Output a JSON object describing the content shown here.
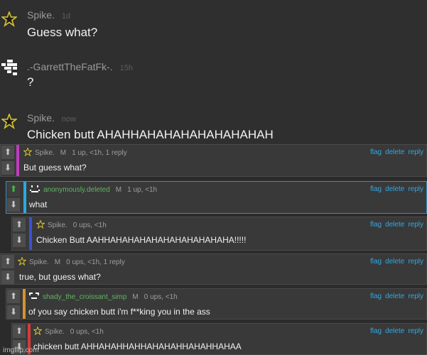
{
  "chat": {
    "messages": [
      {
        "user": "Spike.",
        "time": "1d",
        "text": "Guess what?",
        "avatar": "star-icon"
      },
      {
        "user": ".-GarrettTheFatFk-.",
        "time": "15h",
        "text": "?",
        "avatar": "pixel-avatar-icon"
      },
      {
        "user": "Spike.",
        "time": "now",
        "text": "Chicken butt AHAHHAHAHAHAHAHAHAHAH",
        "avatar": "star-icon"
      }
    ]
  },
  "replies": [
    {
      "user": "Spike.",
      "mod": "M",
      "meta": "1 up, <1h, 1 reply",
      "text": "But guess what?",
      "bar_color": "#c13ac1",
      "upvoted": false
    },
    {
      "user": "anonymously.deleted",
      "mod": "M",
      "meta": "1 up, <1h",
      "text": "what",
      "bar_color": "#2aa9e0",
      "upvoted": true
    },
    {
      "user": "Spike.",
      "mod": "",
      "meta": "0 ups, <1h",
      "text": "Chicken Butt AAHHAHAHAHAHAHAHAHAHAHAHA!!!!!",
      "bar_color": "#3b50d6",
      "upvoted": false
    },
    {
      "user": "Spike.",
      "mod": "M",
      "meta": "0 ups, <1h, 1 reply",
      "text": "true, but guess what?",
      "bar_color": "",
      "upvoted": false
    },
    {
      "user": "shady_the_croissant_simp",
      "mod": "M",
      "meta": "0 ups, <1h",
      "text": "of you say chicken butt i'm f**king you in the ass",
      "bar_color": "#d9902a",
      "upvoted": false
    },
    {
      "user": "Spike.",
      "mod": "",
      "meta": "0 ups, <1h",
      "text": "chicken butt AHHAHAHHAHHAHAHAHHAHAHHAHAA",
      "bar_color": "#d63b3b",
      "upvoted": false
    }
  ],
  "links": {
    "flag": "flag",
    "delete": "delete",
    "reply": "reply"
  },
  "vote_icons": {
    "up": "⬆",
    "down": "⬇"
  },
  "watermark": "imgflip.com",
  "colors": {
    "link": "#32a7e0",
    "green_user": "#5fb55f",
    "star": "#d8c230"
  }
}
